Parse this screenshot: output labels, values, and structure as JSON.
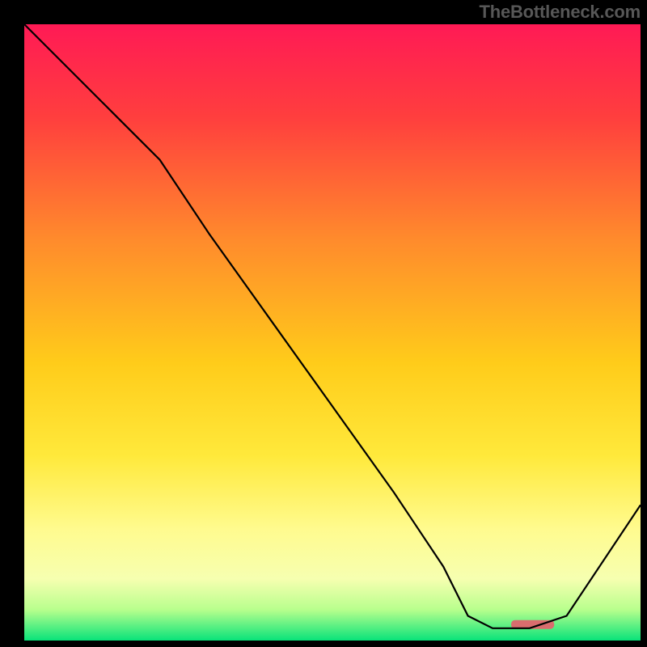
{
  "watermark": "TheBottleneck.com",
  "chart_data": {
    "type": "line",
    "title": "",
    "xlabel": "",
    "ylabel": "",
    "xlim": [
      0,
      100
    ],
    "ylim": [
      0,
      100
    ],
    "grid": false,
    "legend": false,
    "gradient_stops": [
      {
        "pct": 0,
        "color": "#ff1a55"
      },
      {
        "pct": 15,
        "color": "#ff3e3e"
      },
      {
        "pct": 35,
        "color": "#ff8b2c"
      },
      {
        "pct": 55,
        "color": "#ffcc1a"
      },
      {
        "pct": 70,
        "color": "#ffe93b"
      },
      {
        "pct": 82,
        "color": "#fffb8f"
      },
      {
        "pct": 90,
        "color": "#f6ffb0"
      },
      {
        "pct": 95,
        "color": "#b8ff8d"
      },
      {
        "pct": 100,
        "color": "#09e37a"
      }
    ],
    "series": [
      {
        "name": "curve",
        "color": "#000000",
        "width": 2.2,
        "x": [
          0,
          8,
          15,
          22,
          30,
          40,
          50,
          60,
          68,
          72,
          76,
          82,
          88,
          100
        ],
        "y": [
          100,
          92,
          85,
          78,
          66,
          52,
          38,
          24,
          12,
          4,
          2,
          2,
          4,
          22
        ]
      },
      {
        "name": "marker",
        "color": "#d96d6e",
        "type": "bar",
        "x": [
          79,
          86
        ],
        "y": [
          2.6,
          2.6
        ]
      }
    ]
  }
}
